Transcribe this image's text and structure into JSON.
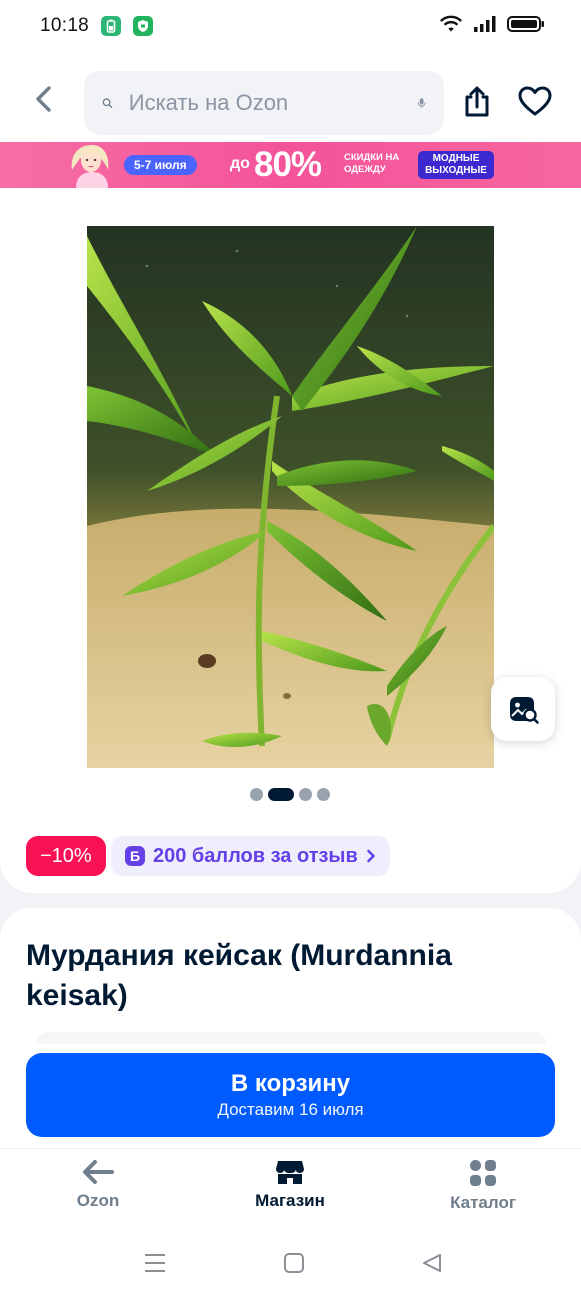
{
  "status_bar": {
    "time": "10:18"
  },
  "header": {
    "search_placeholder": "Искать на Ozon"
  },
  "promo": {
    "dates": "5-7 июля",
    "upto": "до",
    "percent": "80%",
    "sale_text": "СКИДКИ НА ОДЕЖДУ",
    "tag": "МОДНЫЕ ВЫХОДНЫЕ"
  },
  "gallery": {
    "total_images": 4,
    "active_index": 1
  },
  "badges": {
    "discount": "−10%",
    "points_letter": "Б",
    "points_text": "200 баллов за отзыв"
  },
  "product": {
    "title": "Мурдания кейсак (Murdannia keisak)"
  },
  "cart_button": {
    "label": "В корзину",
    "delivery": "Доставим 16 июля"
  },
  "bottom_nav": {
    "items": [
      {
        "label": "Ozon",
        "icon": "arrow-left-icon"
      },
      {
        "label": "Магазин",
        "icon": "store-icon",
        "active": true
      },
      {
        "label": "Каталог",
        "icon": "grid-icon"
      }
    ]
  },
  "colors": {
    "brand_blue": "#005bff",
    "discount_red": "#f91155",
    "points_purple": "#6440e6",
    "promo_pink": "#f4539a"
  }
}
